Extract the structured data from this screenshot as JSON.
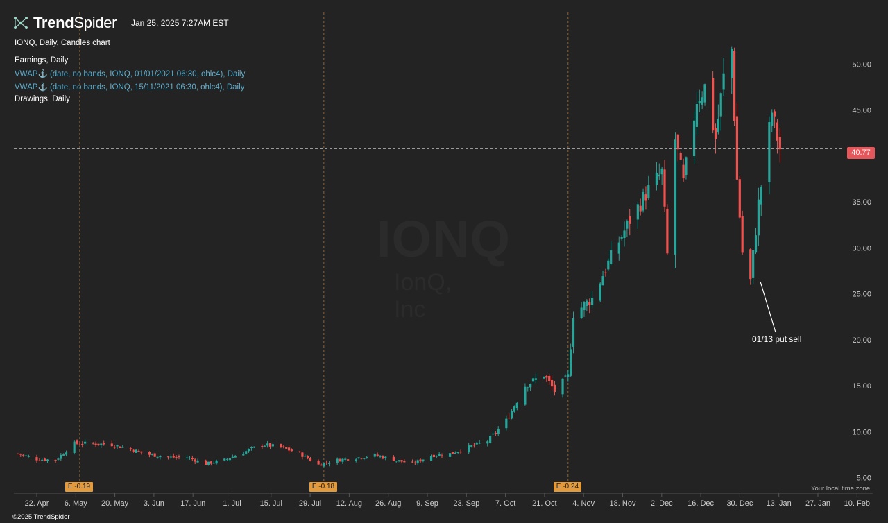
{
  "header": {
    "brand_bold": "Trend",
    "brand_light": "Spider",
    "timestamp": "Jan 25, 2025 7:27AM EST",
    "legend": [
      {
        "text": "IONQ, Daily, Candles chart",
        "color": "white"
      },
      {
        "text": "Earnings, Daily",
        "color": "white"
      },
      {
        "text": "VWAP⚓ (date, no bands, IONQ, 01/01/2021 06:30, ohlc4), Daily",
        "color": "blue"
      },
      {
        "text": "VWAP⚓ (date, no bands, IONQ, 15/11/2021 06:30, ohlc4), Daily",
        "color": "blue"
      },
      {
        "text": "Drawings, Daily",
        "color": "white"
      }
    ]
  },
  "watermark": {
    "symbol": "IONQ",
    "name": "IonQ, Inc"
  },
  "current_price": "40.77",
  "annotation": "01/13 put sell",
  "timezone_label": "Your local time zone",
  "copyright": "©2025 TrendSpider",
  "earnings": [
    {
      "label": "E -0.19",
      "date": "2024-05-08"
    },
    {
      "label": "E -0.18",
      "date": "2024-08-07"
    },
    {
      "label": "E -0.24",
      "date": "2024-11-06"
    }
  ],
  "colors": {
    "background": "#232323",
    "up": "#26a69a",
    "down": "#ef5350",
    "earnings": "#e29a3c",
    "price_tag": "#e5575a",
    "axis_text": "#cfcfcf"
  },
  "chart_data": {
    "type": "candlestick",
    "symbol": "IONQ",
    "interval": "Daily",
    "y_axis": {
      "ticks": [
        5,
        10,
        15,
        20,
        25,
        30,
        35,
        40,
        45,
        50
      ],
      "labels": [
        "5.00",
        "10.00",
        "15.00",
        "20.00",
        "25.00",
        "30.00",
        "35.00",
        "40.00",
        "45.00",
        "50.00"
      ],
      "range": [
        3.5,
        55
      ],
      "position": "right"
    },
    "x_axis": {
      "labels": [
        "22. Apr",
        "6. May",
        "20. May",
        "3. Jun",
        "17. Jun",
        "1. Jul",
        "15. Jul",
        "29. Jul",
        "12. Aug",
        "26. Aug",
        "9. Sep",
        "23. Sep",
        "7. Oct",
        "21. Oct",
        "4. Nov",
        "18. Nov",
        "2. Dec",
        "16. Dec",
        "30. Dec",
        "13. Jan",
        "27. Jan",
        "10. Feb"
      ]
    },
    "last_price": 40.77,
    "price_path": [
      [
        "2024-04-15",
        7.6
      ],
      [
        "2024-04-22",
        7.0
      ],
      [
        "2024-04-29",
        6.9
      ],
      [
        "2024-05-06",
        8.7
      ],
      [
        "2024-05-13",
        8.7
      ],
      [
        "2024-05-20",
        8.6
      ],
      [
        "2024-06-03",
        7.5
      ],
      [
        "2024-06-10",
        7.2
      ],
      [
        "2024-06-17",
        7.2
      ],
      [
        "2024-06-24",
        6.5
      ],
      [
        "2024-07-01",
        6.9
      ],
      [
        "2024-07-15",
        8.6
      ],
      [
        "2024-07-22",
        8.3
      ],
      [
        "2024-07-29",
        7.6
      ],
      [
        "2024-08-05",
        6.4
      ],
      [
        "2024-08-12",
        6.9
      ],
      [
        "2024-08-26",
        7.4
      ],
      [
        "2024-09-09",
        6.5
      ],
      [
        "2024-09-16",
        7.4
      ],
      [
        "2024-09-23",
        7.6
      ],
      [
        "2024-10-07",
        9.0
      ],
      [
        "2024-10-14",
        11.2
      ],
      [
        "2024-10-21",
        15.0
      ],
      [
        "2024-10-28",
        16.2
      ],
      [
        "2024-11-01",
        14.4
      ],
      [
        "2024-11-06",
        16.0
      ],
      [
        "2024-11-08",
        22.8
      ],
      [
        "2024-11-15",
        24.5
      ],
      [
        "2024-11-22",
        29.0
      ],
      [
        "2024-11-29",
        33.0
      ],
      [
        "2024-12-06",
        36.3
      ],
      [
        "2024-12-11",
        38.2
      ],
      [
        "2024-12-13",
        29.2
      ],
      [
        "2024-12-16",
        41.8
      ],
      [
        "2024-12-19",
        37.0
      ],
      [
        "2024-12-24",
        46.2
      ],
      [
        "2024-12-27",
        47.5
      ],
      [
        "2024-12-31",
        41.9
      ],
      [
        "2025-01-03",
        48.5
      ],
      [
        "2025-01-06",
        51.6
      ],
      [
        "2025-01-08",
        37.4
      ],
      [
        "2025-01-10",
        29.5
      ],
      [
        "2025-01-13",
        26.4
      ],
      [
        "2025-01-16",
        34.8
      ],
      [
        "2025-01-21",
        44.8
      ],
      [
        "2025-01-23",
        42.0
      ],
      [
        "2025-01-24",
        40.77
      ]
    ]
  }
}
